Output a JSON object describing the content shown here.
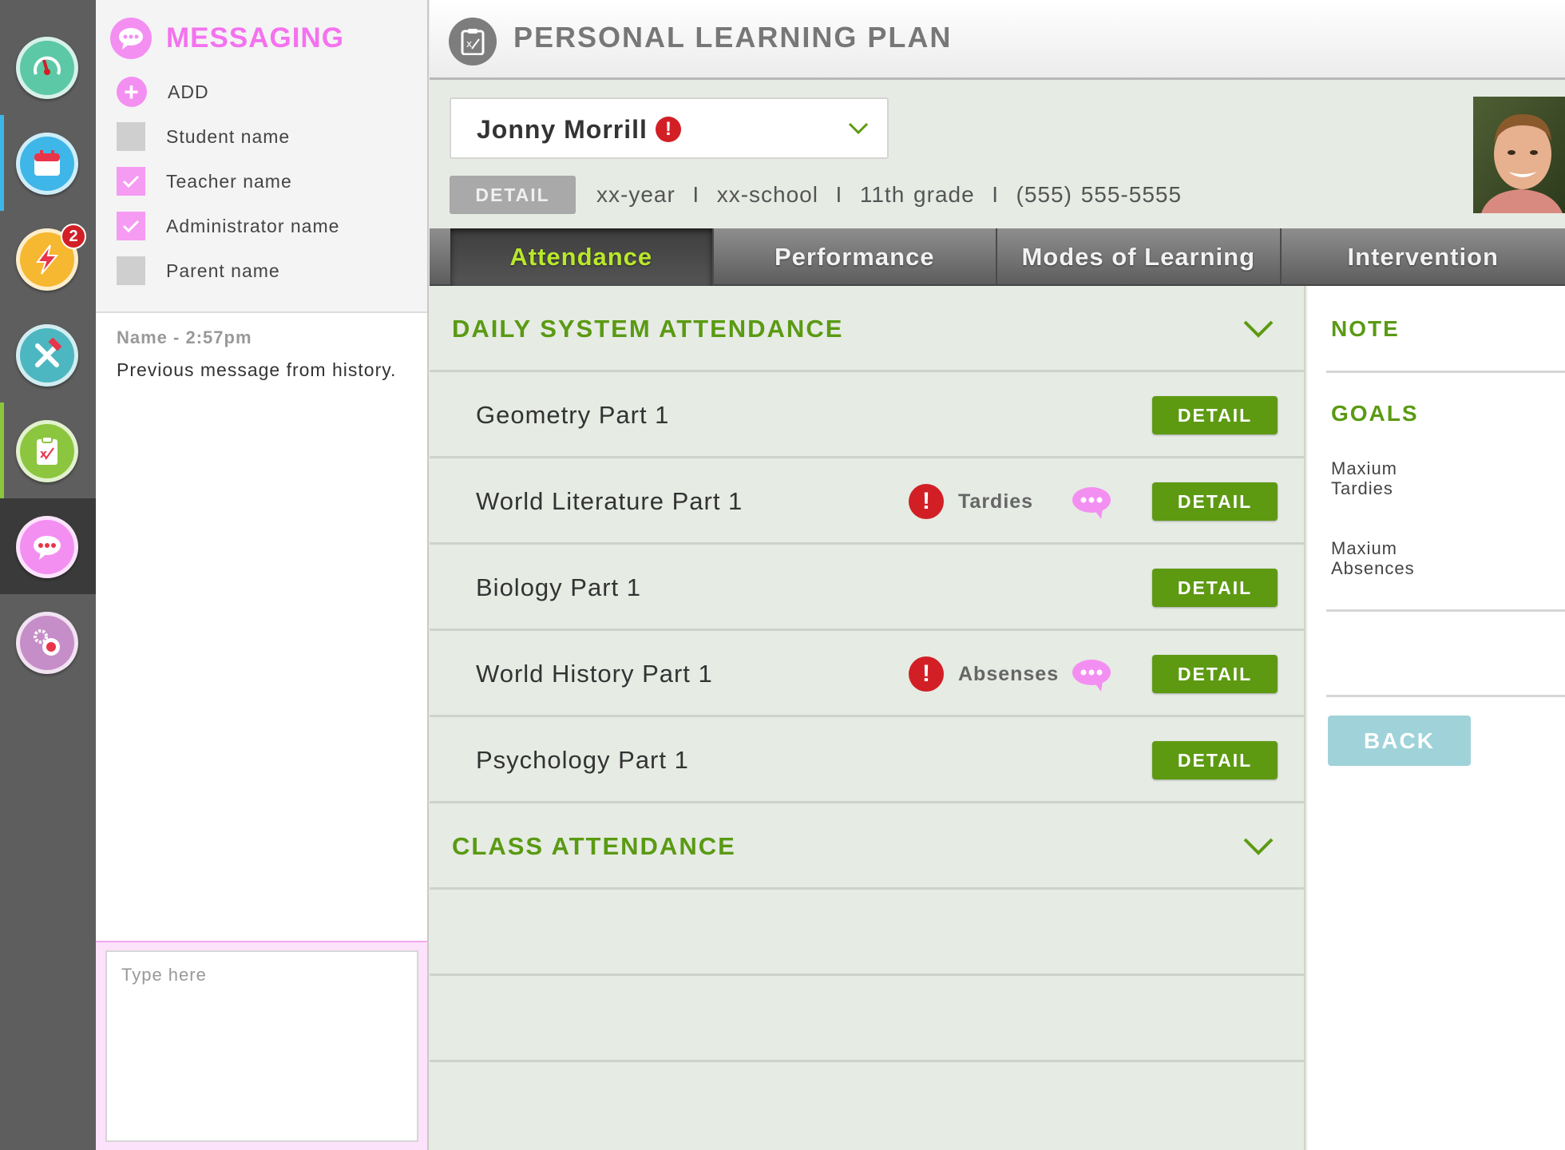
{
  "app": {
    "header_title": "PERSONAL LEARNING PLAN"
  },
  "nav_rail": {
    "items": [
      {
        "icon": "gauge-icon",
        "color": "#5cc8a6"
      },
      {
        "icon": "calendar-icon",
        "color": "#3fb6e8"
      },
      {
        "icon": "lightning-icon",
        "color": "#f6b731",
        "badge": "2"
      },
      {
        "icon": "tools-icon",
        "color": "#4db7c1"
      },
      {
        "icon": "clipboard-plan-icon",
        "color": "#8cc63f"
      },
      {
        "icon": "chat-bubble-icon",
        "color": "#f48ff2"
      },
      {
        "icon": "settings-gears-icon",
        "color": "#c68ec8"
      }
    ]
  },
  "messaging": {
    "title": "MESSAGING",
    "add_label": "ADD",
    "recipients": [
      {
        "label": "Student name",
        "checked": false
      },
      {
        "label": "Teacher name",
        "checked": true
      },
      {
        "label": "Administrator name",
        "checked": true
      },
      {
        "label": "Parent name",
        "checked": false
      }
    ],
    "history": {
      "meta": "Name - 2:57pm",
      "body": "Previous message from history."
    },
    "compose_placeholder": "Type here"
  },
  "student": {
    "name": "Jonny Morrill",
    "alert": "!",
    "detail_label": "DETAIL",
    "info": "xx-year  I  xx-school  I  11th grade  I  (555) 555-5555"
  },
  "tabs": [
    {
      "label": "Attendance",
      "active": true
    },
    {
      "label": "Performance",
      "active": false
    },
    {
      "label": "Modes of Learning",
      "active": false
    },
    {
      "label": "Intervention",
      "active": false
    }
  ],
  "attendance": {
    "daily_title": "DAILY SYSTEM ATTENDANCE",
    "class_title": "CLASS ATTENDANCE",
    "detail_label": "DETAIL",
    "rows": [
      {
        "name": "Geometry Part 1",
        "warning": null
      },
      {
        "name": "World Literature Part 1",
        "warning": "Tardies"
      },
      {
        "name": "Biology Part 1",
        "warning": null
      },
      {
        "name": "World History Part 1",
        "warning": "Absenses"
      },
      {
        "name": "Psychology Part 1",
        "warning": null
      }
    ]
  },
  "side_panel": {
    "note_label": "NOTE",
    "goals_label": "GOALS",
    "goal_tardies": [
      "Maxium",
      "Tardies"
    ],
    "goal_absences": [
      "Maxium",
      "Absences"
    ],
    "back_label": "BACK"
  },
  "colors": {
    "accent_green": "#5d9a12",
    "section_green": "#5a9a13",
    "messaging_pink": "#f472ef",
    "alert_red": "#d21f26",
    "back_teal": "#9fd3d9"
  }
}
